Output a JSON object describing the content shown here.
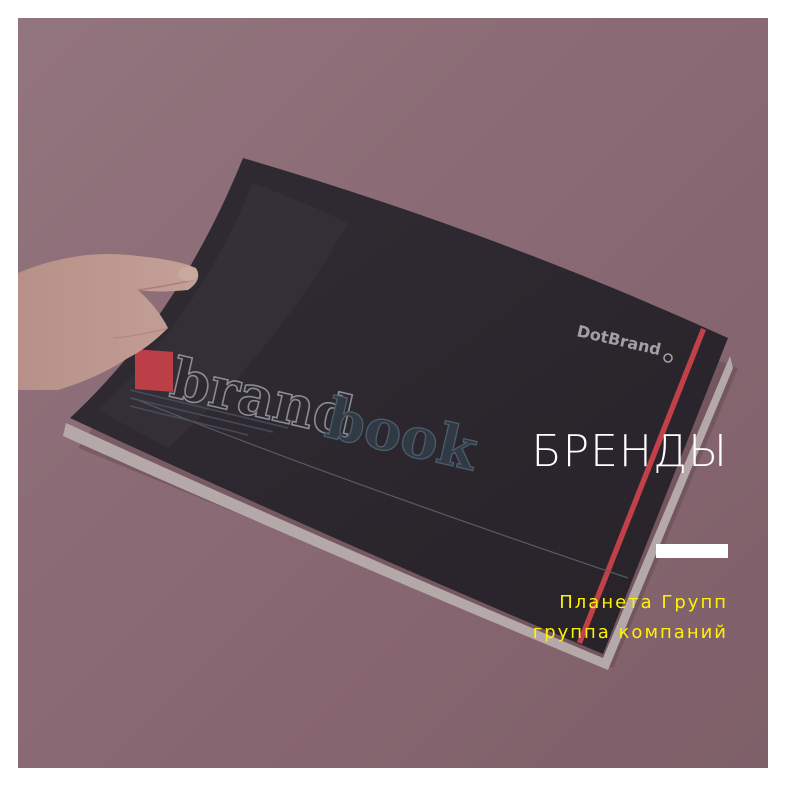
{
  "photo": {
    "background_color": "#9b7a83",
    "cover_color": "#2b2b30",
    "accent_color": "#e0484f",
    "description_icon": "brandbook-photo",
    "cover_logo": "DotBrand",
    "cover_word_1": "brand",
    "cover_word_2": "book"
  },
  "caption": {
    "title": "БРЕНДЫ",
    "line_1": "Планета Групп",
    "line_2": "группа компаний"
  },
  "colors": {
    "title": "#ffffff",
    "subtitle": "#fff200",
    "divider": "#ffffff"
  }
}
